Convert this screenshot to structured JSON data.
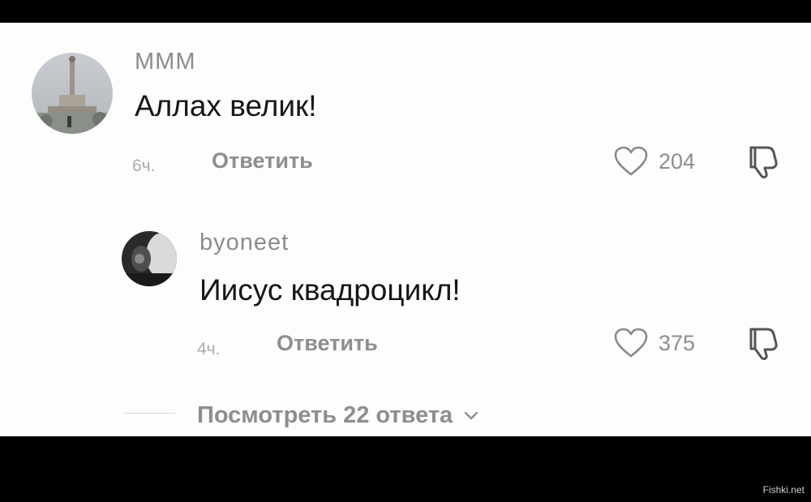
{
  "comments": [
    {
      "username": "МММ",
      "text": "Аллах велик!",
      "time": "6ч.",
      "reply_label": "Ответить",
      "likes": "204",
      "avatar_icon": "monument-photo-avatar",
      "replies": [
        {
          "username": "byoneet",
          "text": "Иисус квадроцикл!",
          "time": "4ч.",
          "reply_label": "Ответить",
          "likes": "375",
          "avatar_icon": "dark-photo-avatar"
        }
      ],
      "view_replies_label": "Посмотреть 22 ответа"
    }
  ],
  "icons": {
    "like": "heart-outline-icon",
    "dislike": "thumbs-down-icon",
    "expand": "chevron-down-icon"
  },
  "watermark": "Fishki.net",
  "colors": {
    "background": "#fdfdfd",
    "text": "#161616",
    "muted": "#8e8e8e"
  }
}
